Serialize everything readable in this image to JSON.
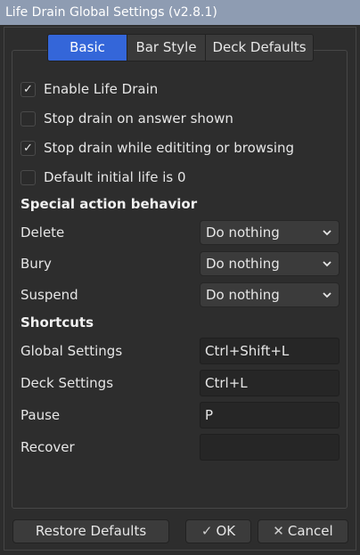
{
  "window": {
    "title": "Life Drain Global Settings (v2.8.1)"
  },
  "tabs": [
    {
      "label": "Basic",
      "active": true
    },
    {
      "label": "Bar Style",
      "active": false
    },
    {
      "label": "Deck Defaults",
      "active": false
    }
  ],
  "options": [
    {
      "label": "Enable Life Drain",
      "checked": true
    },
    {
      "label": "Stop drain on answer shown",
      "checked": false
    },
    {
      "label": "Stop drain while edititing or browsing",
      "checked": true
    },
    {
      "label": "Default initial life is 0",
      "checked": false
    }
  ],
  "special_actions": {
    "heading": "Special action behavior",
    "rows": [
      {
        "label": "Delete",
        "value": "Do nothing"
      },
      {
        "label": "Bury",
        "value": "Do nothing"
      },
      {
        "label": "Suspend",
        "value": "Do nothing"
      }
    ]
  },
  "shortcuts": {
    "heading": "Shortcuts",
    "rows": [
      {
        "label": "Global Settings",
        "value": "Ctrl+Shift+L"
      },
      {
        "label": "Deck Settings",
        "value": "Ctrl+L"
      },
      {
        "label": "Pause",
        "value": "P"
      },
      {
        "label": "Recover",
        "value": ""
      }
    ]
  },
  "buttons": {
    "restore": "Restore Defaults",
    "ok": "OK",
    "cancel": "Cancel",
    "ok_glyph": "✓",
    "cancel_glyph": "✕"
  },
  "icons": {
    "check": "✓"
  },
  "colors": {
    "accent": "#3466d9",
    "titlebar": "#8e9cb2",
    "background": "#2d2d2d"
  }
}
